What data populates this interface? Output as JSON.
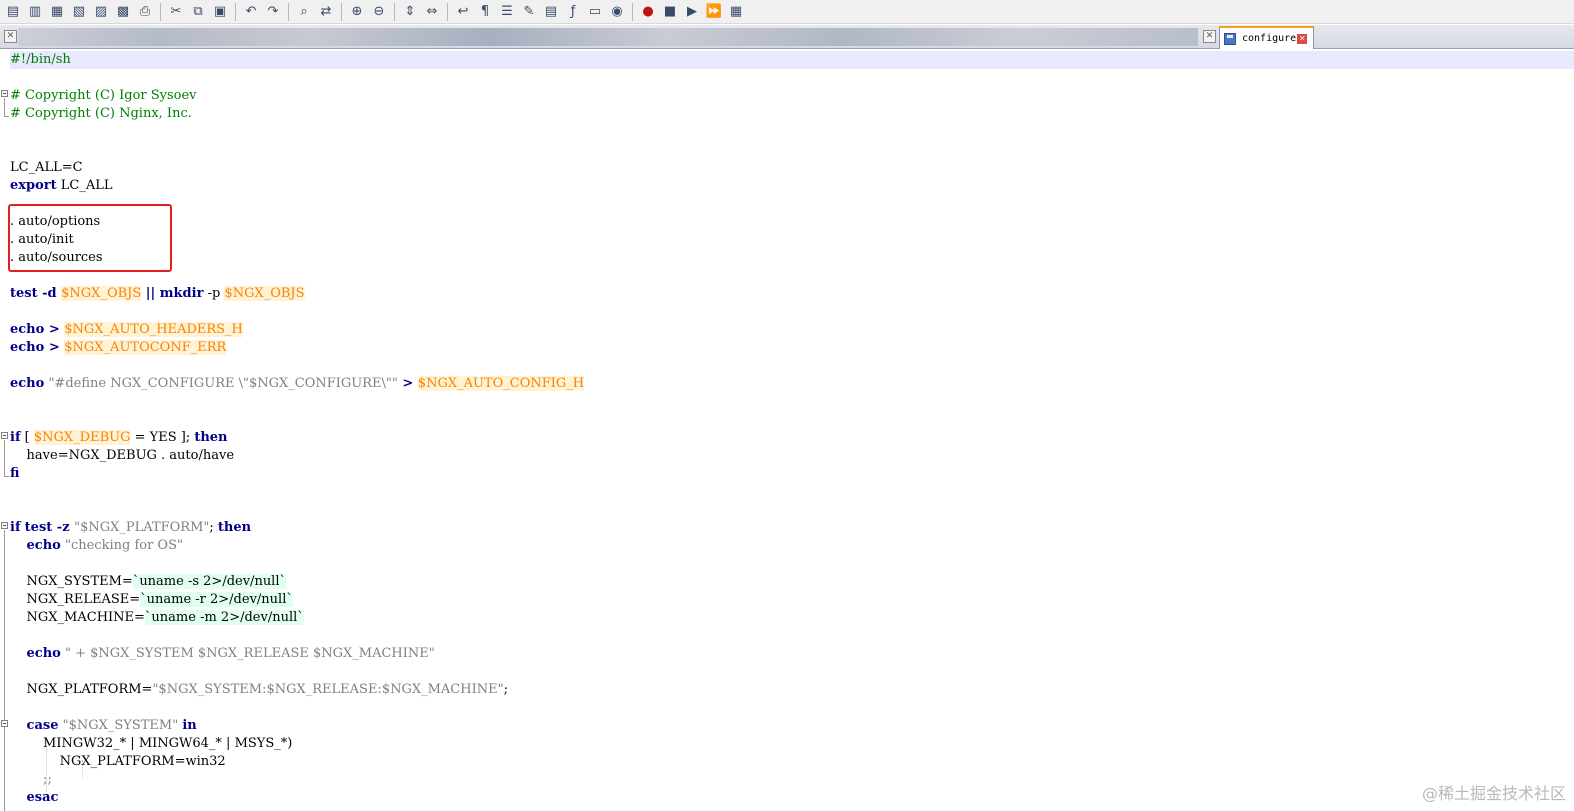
{
  "toolbar": {
    "buttons": [
      "new-file-icon",
      "open-file-icon",
      "save-icon",
      "save-all-icon",
      "close-icon",
      "close-all-icon",
      "print-icon",
      "cut-icon",
      "copy-icon",
      "paste-icon",
      "undo-icon",
      "redo-icon",
      "find-icon",
      "replace-icon",
      "zoom-in-icon",
      "zoom-out-icon",
      "sync-vertical-icon",
      "sync-horizontal-icon",
      "word-wrap-icon",
      "show-all-chars-icon",
      "indent-guide-icon",
      "user-language-icon",
      "doc-map-icon",
      "function-list-icon",
      "folder-workspace-icon",
      "monitoring-icon",
      "record-macro-icon",
      "stop-macro-icon",
      "play-macro-icon",
      "run-macro-multiple-icon",
      "save-macro-icon"
    ]
  },
  "tabs": {
    "active": {
      "label": "configure",
      "close_glyph": "✕"
    },
    "small_close_glyph": "✕"
  },
  "editor": {
    "lines": [
      {
        "row": 0,
        "current": true,
        "tokens": [
          {
            "t": "#!/bin/sh",
            "c": "cmt"
          }
        ]
      },
      {
        "row": 2,
        "tokens": [
          {
            "t": "# Copyright (C) Igor Sysoev",
            "c": "cmt"
          }
        ]
      },
      {
        "row": 3,
        "tokens": [
          {
            "t": "# Copyright (C) Nginx, Inc.",
            "c": "cmt"
          }
        ]
      },
      {
        "row": 6,
        "tokens": [
          {
            "t": "LC_ALL=C",
            "c": ""
          }
        ]
      },
      {
        "row": 7,
        "tokens": [
          {
            "t": "export",
            "c": "kw"
          },
          {
            "t": " LC_ALL",
            "c": ""
          }
        ]
      },
      {
        "row": 9,
        "tokens": [
          {
            "t": ". auto/options",
            "c": ""
          }
        ]
      },
      {
        "row": 10,
        "tokens": [
          {
            "t": ". auto/init",
            "c": ""
          }
        ]
      },
      {
        "row": 11,
        "tokens": [
          {
            "t": ". auto/sources",
            "c": ""
          }
        ]
      },
      {
        "row": 13,
        "tokens": [
          {
            "t": "test",
            "c": "kw"
          },
          {
            "t": " -d ",
            "c": "op"
          },
          {
            "t": "$NGX_OBJS",
            "c": "var"
          },
          {
            "t": " || ",
            "c": "op"
          },
          {
            "t": "mkdir",
            "c": "kw"
          },
          {
            "t": " -p ",
            "c": ""
          },
          {
            "t": "$NGX_OBJS",
            "c": "var"
          }
        ]
      },
      {
        "row": 15,
        "tokens": [
          {
            "t": "echo",
            "c": "kw"
          },
          {
            "t": " > ",
            "c": "op"
          },
          {
            "t": "$NGX_AUTO_HEADERS_H",
            "c": "var"
          }
        ]
      },
      {
        "row": 16,
        "tokens": [
          {
            "t": "echo",
            "c": "kw"
          },
          {
            "t": " > ",
            "c": "op"
          },
          {
            "t": "$NGX_AUTOCONF_ERR",
            "c": "var"
          }
        ]
      },
      {
        "row": 18,
        "tokens": [
          {
            "t": "echo",
            "c": "kw"
          },
          {
            "t": " \"#define NGX_CONFIGURE \\\"$NGX_CONFIGURE\\\"\"",
            "c": "str"
          },
          {
            "t": " > ",
            "c": "op"
          },
          {
            "t": "$NGX_AUTO_CONFIG_H",
            "c": "var"
          }
        ]
      },
      {
        "row": 21,
        "tokens": [
          {
            "t": "if",
            "c": "kw"
          },
          {
            "t": " [ ",
            "c": ""
          },
          {
            "t": "$NGX_DEBUG",
            "c": "var"
          },
          {
            "t": " = YES ]; ",
            "c": ""
          },
          {
            "t": "then",
            "c": "kw"
          }
        ]
      },
      {
        "row": 22,
        "tokens": [
          {
            "t": "    have=NGX_DEBUG . auto/have",
            "c": ""
          }
        ]
      },
      {
        "row": 23,
        "tokens": [
          {
            "t": "fi",
            "c": "kw"
          }
        ]
      },
      {
        "row": 26,
        "tokens": [
          {
            "t": "if",
            "c": "kw"
          },
          {
            "t": " ",
            "c": ""
          },
          {
            "t": "test",
            "c": "kw"
          },
          {
            "t": " -z ",
            "c": "op"
          },
          {
            "t": "\"$NGX_PLATFORM\"",
            "c": "str"
          },
          {
            "t": "; ",
            "c": ""
          },
          {
            "t": "then",
            "c": "kw"
          }
        ]
      },
      {
        "row": 27,
        "tokens": [
          {
            "t": "    ",
            "c": ""
          },
          {
            "t": "echo",
            "c": "kw"
          },
          {
            "t": " \"checking for OS\"",
            "c": "str"
          }
        ]
      },
      {
        "row": 29,
        "tokens": [
          {
            "t": "    NGX_SYSTEM=",
            "c": ""
          },
          {
            "t": "`uname -s 2>/dev/null`",
            "c": "bq"
          }
        ]
      },
      {
        "row": 30,
        "tokens": [
          {
            "t": "    NGX_RELEASE=",
            "c": ""
          },
          {
            "t": "`uname -r 2>/dev/null`",
            "c": "bq"
          }
        ]
      },
      {
        "row": 31,
        "tokens": [
          {
            "t": "    NGX_MACHINE=",
            "c": ""
          },
          {
            "t": "`uname -m 2>/dev/null`",
            "c": "bq"
          }
        ]
      },
      {
        "row": 33,
        "tokens": [
          {
            "t": "    ",
            "c": ""
          },
          {
            "t": "echo",
            "c": "kw"
          },
          {
            "t": " \" + $NGX_SYSTEM $NGX_RELEASE $NGX_MACHINE\"",
            "c": "str"
          }
        ]
      },
      {
        "row": 35,
        "tokens": [
          {
            "t": "    NGX_PLATFORM=",
            "c": ""
          },
          {
            "t": "\"$NGX_SYSTEM:$NGX_RELEASE:$NGX_MACHINE\"",
            "c": "str"
          },
          {
            "t": ";",
            "c": ""
          }
        ]
      },
      {
        "row": 37,
        "tokens": [
          {
            "t": "    ",
            "c": ""
          },
          {
            "t": "case",
            "c": "kw"
          },
          {
            "t": " \"$NGX_SYSTEM\" ",
            "c": "str"
          },
          {
            "t": "in",
            "c": "kw"
          }
        ]
      },
      {
        "row": 38,
        "tokens": [
          {
            "t": "        MINGW32_* | MINGW64_* | MSYS_*)",
            "c": ""
          }
        ]
      },
      {
        "row": 39,
        "tokens": [
          {
            "t": "            NGX_PLATFORM=win32",
            "c": ""
          }
        ]
      },
      {
        "row": 40,
        "tokens": [
          {
            "t": "        ;;",
            "c": "str"
          }
        ]
      },
      {
        "row": 41,
        "tokens": [
          {
            "t": "    ",
            "c": ""
          },
          {
            "t": "esac",
            "c": "kw"
          }
        ]
      }
    ]
  },
  "watermark": "@稀土掘金技术社区"
}
